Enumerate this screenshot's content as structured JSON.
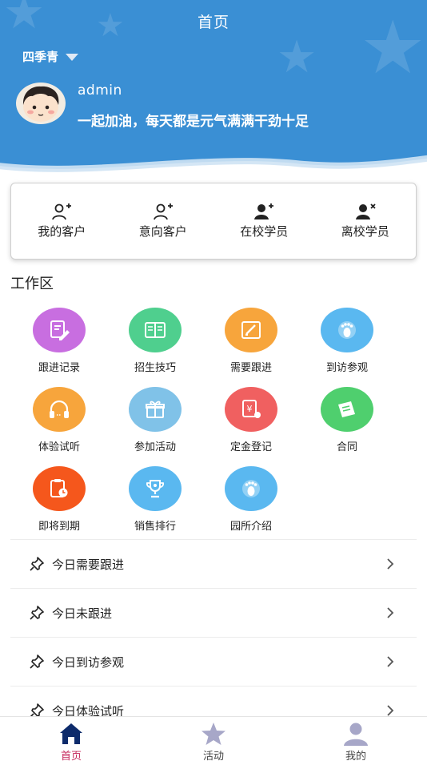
{
  "header": {
    "title": "首页",
    "school_name": "四季青",
    "user": {
      "name": "admin",
      "motto": "一起加油，每天都是元气满满干劲十足"
    },
    "color": "#3a8fd4"
  },
  "quick_actions": [
    {
      "label": "我的客户",
      "icon": "person-add-outline-icon"
    },
    {
      "label": "意向客户",
      "icon": "person-add-outline-icon"
    },
    {
      "label": "在校学员",
      "icon": "person-add-filled-icon"
    },
    {
      "label": "离校学员",
      "icon": "person-remove-filled-icon"
    }
  ],
  "work_area": {
    "title": "工作区",
    "items": [
      {
        "label": "跟进记录",
        "icon": "document-edit-icon",
        "color": "#c86ee0"
      },
      {
        "label": "招生技巧",
        "icon": "book-icon",
        "color": "#4fcf8e"
      },
      {
        "label": "需要跟进",
        "icon": "edit-box-icon",
        "color": "#f7a53c"
      },
      {
        "label": "到访参观",
        "icon": "footprint-icon",
        "color": "#5ab8f0"
      },
      {
        "label": "体验试听",
        "icon": "headphones-icon",
        "color": "#f7a53c"
      },
      {
        "label": "参加活动",
        "icon": "gift-icon",
        "color": "#80c2e8"
      },
      {
        "label": "定金登记",
        "icon": "payment-icon",
        "color": "#f06060"
      },
      {
        "label": "合同",
        "icon": "contract-icon",
        "color": "#4fcf6e"
      },
      {
        "label": "即将到期",
        "icon": "clipboard-clock-icon",
        "color": "#f5571c"
      },
      {
        "label": "销售排行",
        "icon": "trophy-icon",
        "color": "#5ab8f0"
      },
      {
        "label": "园所介绍",
        "icon": "footprint-icon",
        "color": "#5ab8f0"
      }
    ]
  },
  "today_list": [
    {
      "label": "今日需要跟进"
    },
    {
      "label": "今日未跟进"
    },
    {
      "label": "今日到访参观"
    },
    {
      "label": "今日体验试听"
    }
  ],
  "tabbar": {
    "tabs": [
      {
        "label": "首页",
        "icon": "home-icon",
        "active": true
      },
      {
        "label": "活动",
        "icon": "star-icon",
        "active": false
      },
      {
        "label": "我的",
        "icon": "user-icon",
        "active": false
      }
    ],
    "active_color": "#c4255a"
  }
}
